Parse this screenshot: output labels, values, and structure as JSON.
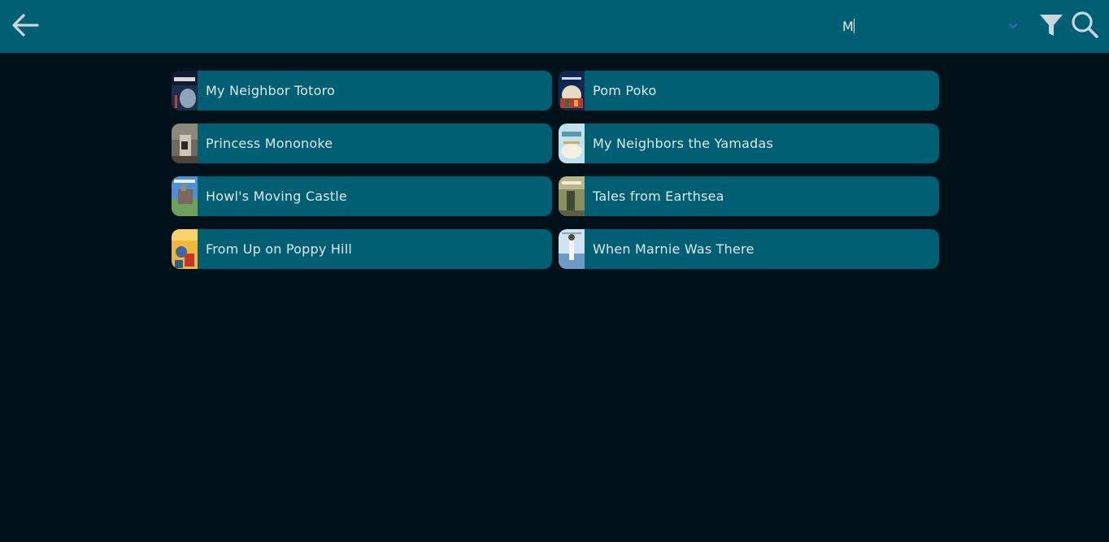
{
  "header": {
    "search": {
      "value": "M",
      "placeholder": ""
    },
    "icons": {
      "back": "arrow-left-icon",
      "dropdown": "chevron-down-icon",
      "filter": "filter-icon",
      "search": "search-icon"
    }
  },
  "results": [
    {
      "title": "My Neighbor Totoro",
      "poster": "my-neighbor-totoro-poster"
    },
    {
      "title": "Pom Poko",
      "poster": "pom-poko-poster"
    },
    {
      "title": "Princess Mononoke",
      "poster": "princess-mononoke-poster"
    },
    {
      "title": "My Neighbors the Yamadas",
      "poster": "my-neighbors-the-yamadas-poster"
    },
    {
      "title": "Howl's Moving Castle",
      "poster": "howls-moving-castle-poster"
    },
    {
      "title": "Tales from Earthsea",
      "poster": "tales-from-earthsea-poster"
    },
    {
      "title": "From Up on Poppy Hill",
      "poster": "from-up-on-poppy-hill-poster"
    },
    {
      "title": "When Marnie Was There",
      "poster": "when-marnie-was-there-poster"
    }
  ],
  "colors": {
    "background": "#00111a",
    "bar": "#005f73",
    "card": "#005f73",
    "text": "#dfe6e9",
    "dropdown_accent": "#4a5fc1"
  }
}
